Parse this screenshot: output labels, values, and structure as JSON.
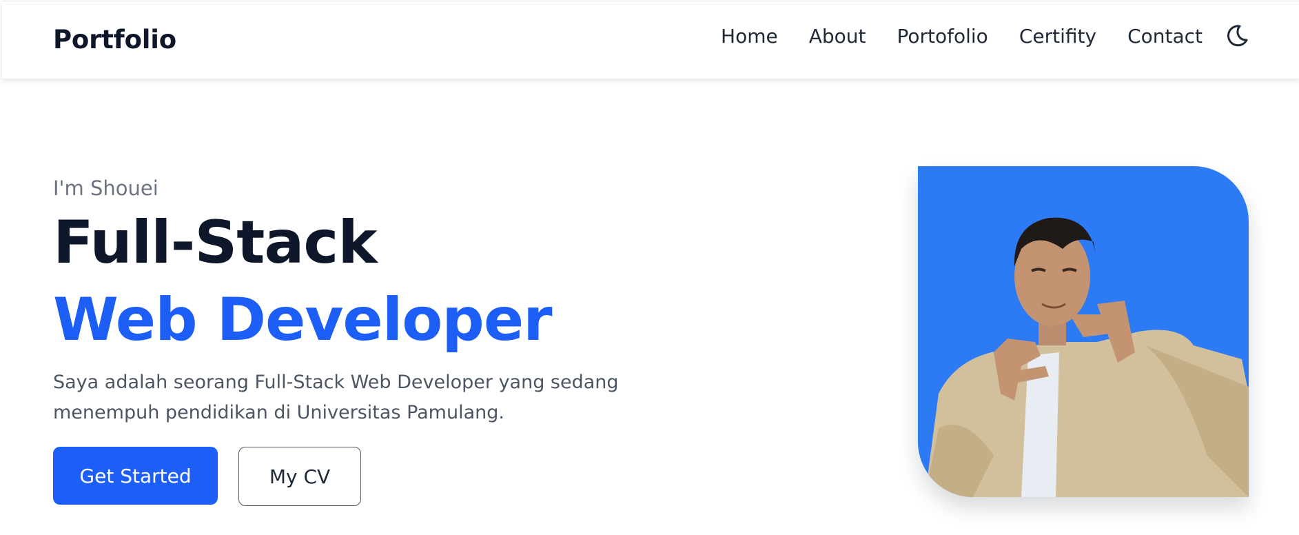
{
  "navbar": {
    "brand": "Portfolio",
    "links": [
      "Home",
      "About",
      "Portofolio",
      "Certifity",
      "Contact"
    ],
    "theme_icon": "moon-icon"
  },
  "hero": {
    "intro": "I'm Shouei",
    "title_line1": "Full-Stack",
    "title_line2": "Web Developer",
    "description": "Saya adalah seorang Full-Stack Web Developer yang sedang menempuh pendidikan di Universitas Pamulang.",
    "primary_button": "Get Started",
    "secondary_button": "My CV"
  },
  "colors": {
    "accent": "#1d5ff6",
    "photo_background": "#2d7bf4",
    "heading": "#0f172a",
    "muted_text": "#6b7280"
  }
}
